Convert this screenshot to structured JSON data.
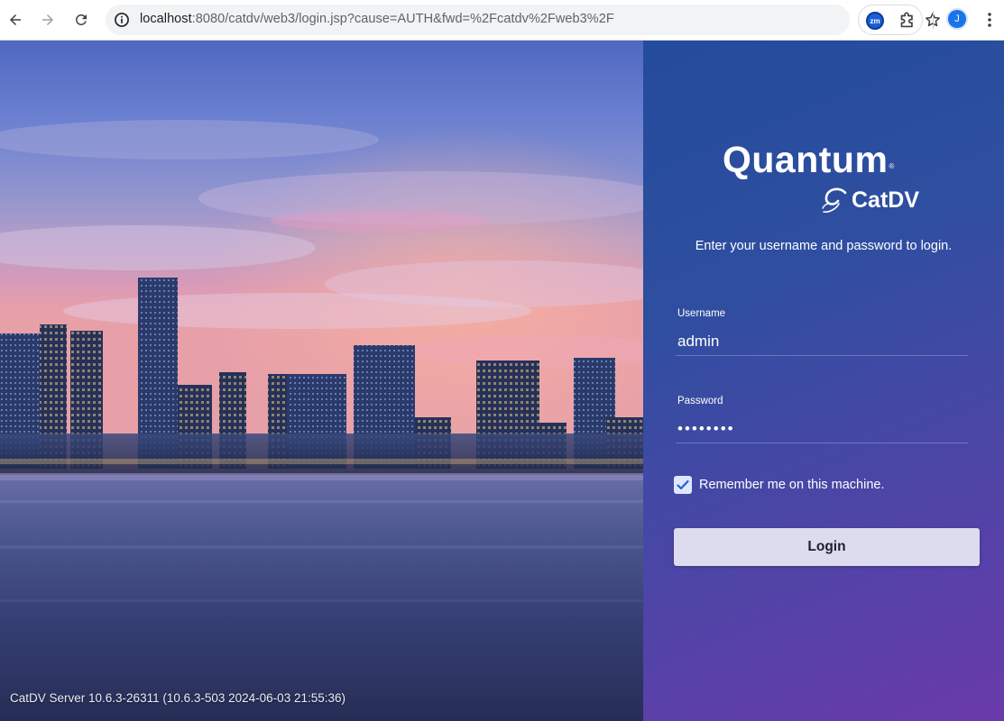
{
  "browser": {
    "url_host": "localhost",
    "url_rest": ":8080/catdv/web3/login.jsp?cause=AUTH&fwd=%2Fcatdv%2Fweb3%2F",
    "extension_label": "zm",
    "profile_initial": "J",
    "icons": [
      "back-arrow-icon",
      "forward-arrow-icon",
      "reload-icon",
      "info-icon",
      "key-icon",
      "star-icon",
      "zoom-extension-icon",
      "puzzle-icon",
      "more-menu-icon"
    ]
  },
  "hero": {
    "version_text": "CatDV Server 10.6.3-26311 (10.6.3-503 2024-06-03 21:55:36)"
  },
  "login": {
    "brand": "Quantum",
    "brand_mark": "®",
    "product": "CatDV",
    "prompt": "Enter your username and password to login.",
    "username_label": "Username",
    "username_value": "admin",
    "password_label": "Password",
    "password_value": "password",
    "remember_label": "Remember me on this machine.",
    "remember_checked": true,
    "login_label": "Login"
  },
  "colors": {
    "panel_top": "#244c9c",
    "panel_bottom": "#6a3aab",
    "button_bg": "#dcdcee",
    "checkbox_bg": "#dde8ff"
  }
}
